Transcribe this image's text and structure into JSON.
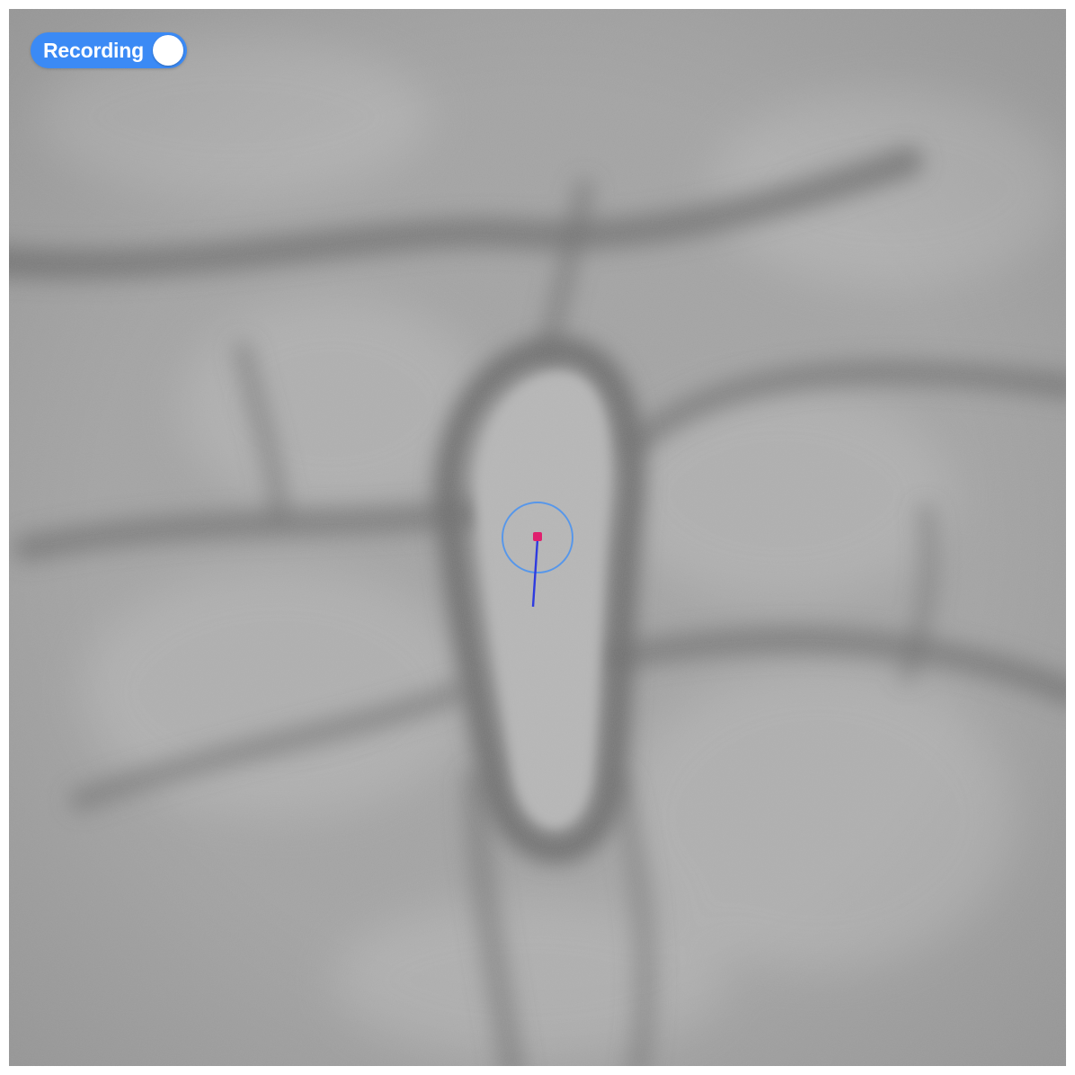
{
  "recording_toggle": {
    "label": "Recording",
    "state": "on",
    "color": "#3b8af5"
  },
  "scene": {
    "background": "#a3a3a3",
    "cursor_ring_color": "#4d93f0",
    "cursor_dot_color": "#e0206e",
    "heading_line_color": "#2e3be0"
  }
}
